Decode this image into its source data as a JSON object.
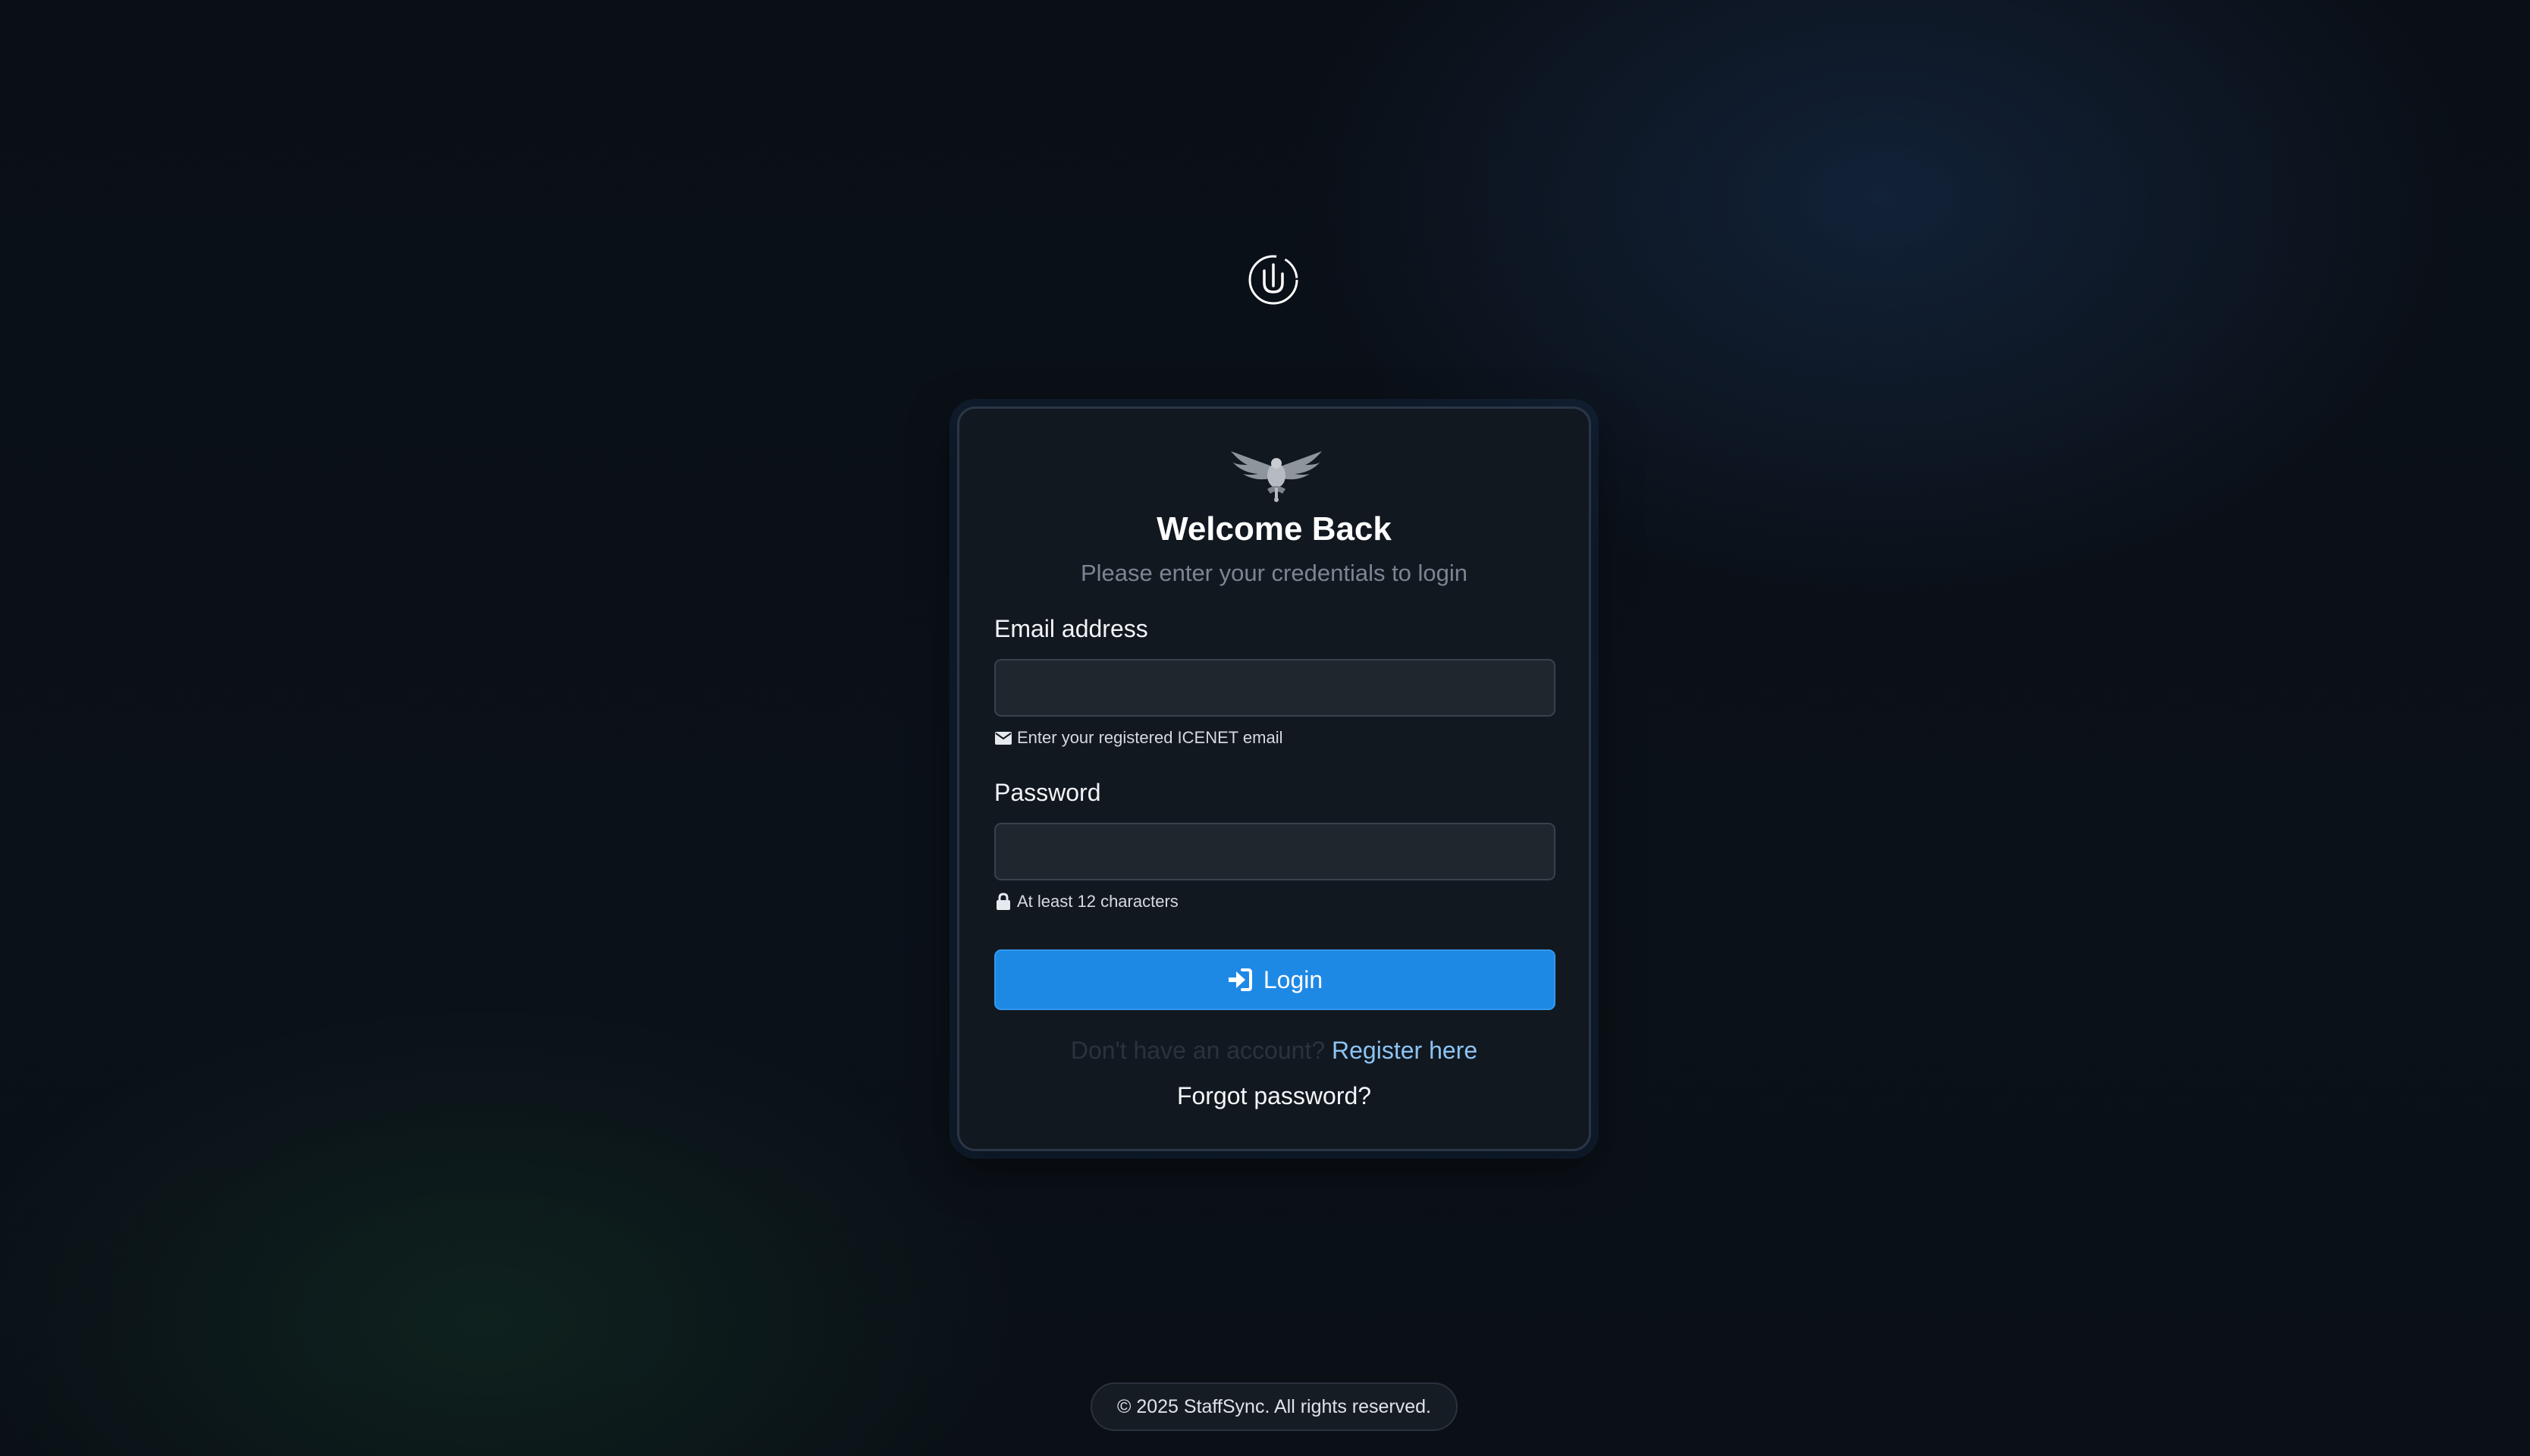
{
  "brand": {
    "logo_icon": "brand-circle-logo-icon"
  },
  "login_card": {
    "emblem_icon": "eagle-emblem-icon",
    "title": "Welcome Back",
    "subtitle": "Please enter your credentials to login",
    "email": {
      "label": "Email address",
      "value": "",
      "placeholder": "",
      "hint": "Enter your registered ICENET email",
      "hint_icon": "envelope-icon"
    },
    "password": {
      "label": "Password",
      "value": "",
      "placeholder": "",
      "hint": "At least 12 characters",
      "hint_icon": "lock-icon"
    },
    "login_button": {
      "label": "Login",
      "icon": "sign-in-icon"
    },
    "register_prompt": "Don't have an account?",
    "register_link": "Register here",
    "forgot_password": "Forgot password?"
  },
  "footer": {
    "copyright": "© 2025 StaffSync. All rights reserved."
  },
  "colors": {
    "background": "#0a0f16",
    "card": "#121820",
    "accent": "#1e88e5",
    "link": "#8cc4f5"
  }
}
